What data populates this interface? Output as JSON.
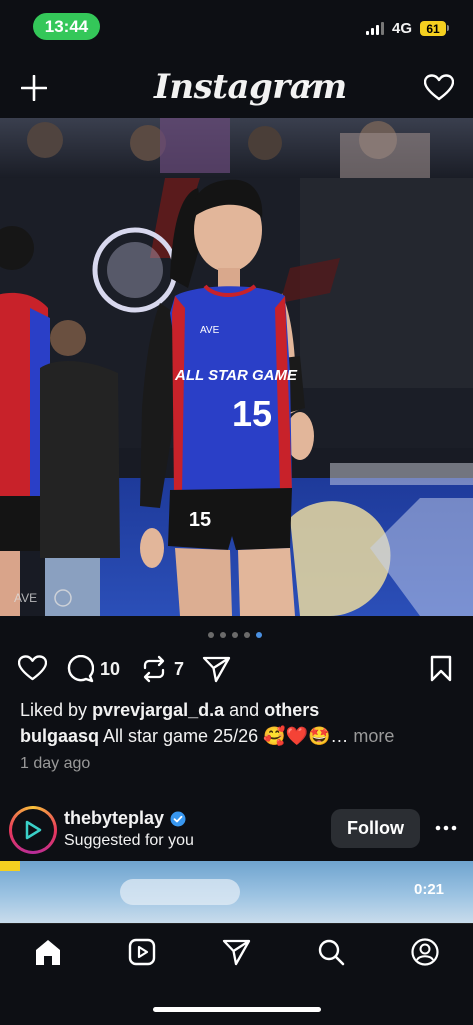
{
  "status_bar": {
    "time": "13:44",
    "network": "4G",
    "battery": "61"
  },
  "header": {
    "title": "Instagram"
  },
  "post": {
    "carousel": {
      "count": 5,
      "active_index": 4
    },
    "photo": {
      "jersey_number": "15",
      "shorts_number": "15",
      "jersey_text": "ALL STAR GAME",
      "sponsor": "AVE"
    },
    "actions": {
      "comments_count": "10",
      "reposts_count": "7"
    },
    "likes": {
      "prefix": "Liked by",
      "user": "pvrevjargal_d.a",
      "joiner": "and",
      "others": "others"
    },
    "caption": {
      "user": "bulgaasq",
      "text": "All star game 25/26 🥰❤️🤩…",
      "more": "more"
    },
    "time_ago": "1 day ago"
  },
  "suggested": {
    "username": "thebyteplay",
    "subtitle": "Suggested for you",
    "follow_label": "Follow",
    "video_time": "0:21"
  },
  "colors": {
    "accent_green": "#34c759",
    "battery": "#f5d020",
    "verified": "#3897f0",
    "jersey": "#2a3fc7"
  }
}
